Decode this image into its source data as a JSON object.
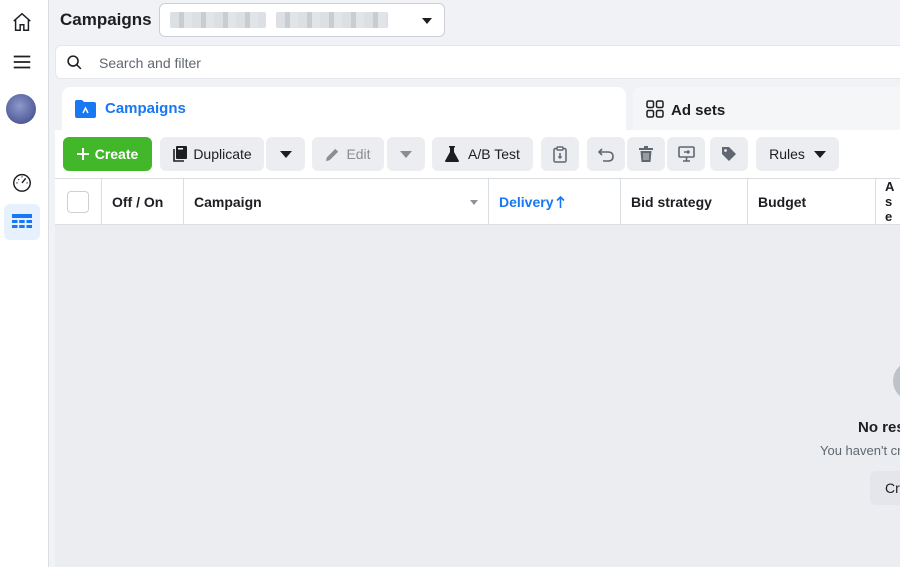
{
  "header": {
    "title": "Campaigns",
    "account_selector_value": ""
  },
  "rail": {
    "icons": [
      "home-icon",
      "menu-icon",
      "avatar",
      "dashboard-icon",
      "campaigns-table-icon"
    ]
  },
  "search": {
    "placeholder": "Search and filter"
  },
  "tabs": [
    {
      "label": "Campaigns",
      "active": true,
      "icon": "folder-icon"
    },
    {
      "label": "Ad sets",
      "active": false,
      "icon": "grid-icon"
    }
  ],
  "toolbar": {
    "create_label": "Create",
    "duplicate_label": "Duplicate",
    "edit_label": "Edit",
    "ab_test_label": "A/B Test",
    "rules_label": "Rules"
  },
  "table": {
    "columns": [
      "Off / On",
      "Campaign",
      "Delivery",
      "Bid strategy",
      "Budget",
      "A se"
    ],
    "sorted_column": "Delivery"
  },
  "empty_state": {
    "title": "No res",
    "subtitle": "You haven't cr",
    "button_label": "Cr"
  },
  "colors": {
    "accent": "#1877f2",
    "create_green": "#42b72a"
  }
}
